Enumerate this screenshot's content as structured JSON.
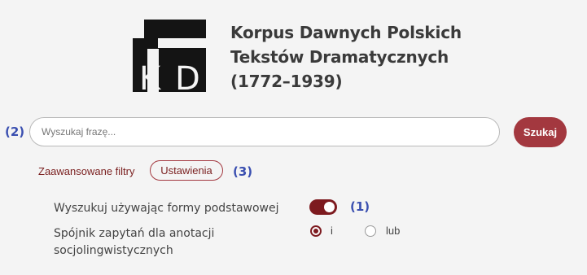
{
  "logo": {
    "letters": "KTD"
  },
  "title": {
    "line1": "Korpus Dawnych Polskich",
    "line2": "Tekstów Dramatycznych",
    "line3": "(1772–1939)"
  },
  "search": {
    "placeholder": "Wyszukaj frazę...",
    "value": "",
    "button_label": "Szukaj"
  },
  "filters": {
    "advanced_label": "Zaawansowane filtry",
    "settings_label": "Ustawienia"
  },
  "options": {
    "base_form": {
      "label": "Wyszukuj używając formy podstawowej",
      "enabled": true
    },
    "conjunction": {
      "label_line1": "Spójnik zapytań dla anotacji",
      "label_line2": "socjolingwistycznych",
      "choices": [
        "i",
        "lub"
      ],
      "selected": "i"
    }
  },
  "annotations": {
    "a1": "(1)",
    "a2": "(2)",
    "a3": "(3)"
  },
  "colors": {
    "accent": "#a3383f",
    "toggle": "#7d1a1f",
    "annotation": "#3a4fb0"
  }
}
